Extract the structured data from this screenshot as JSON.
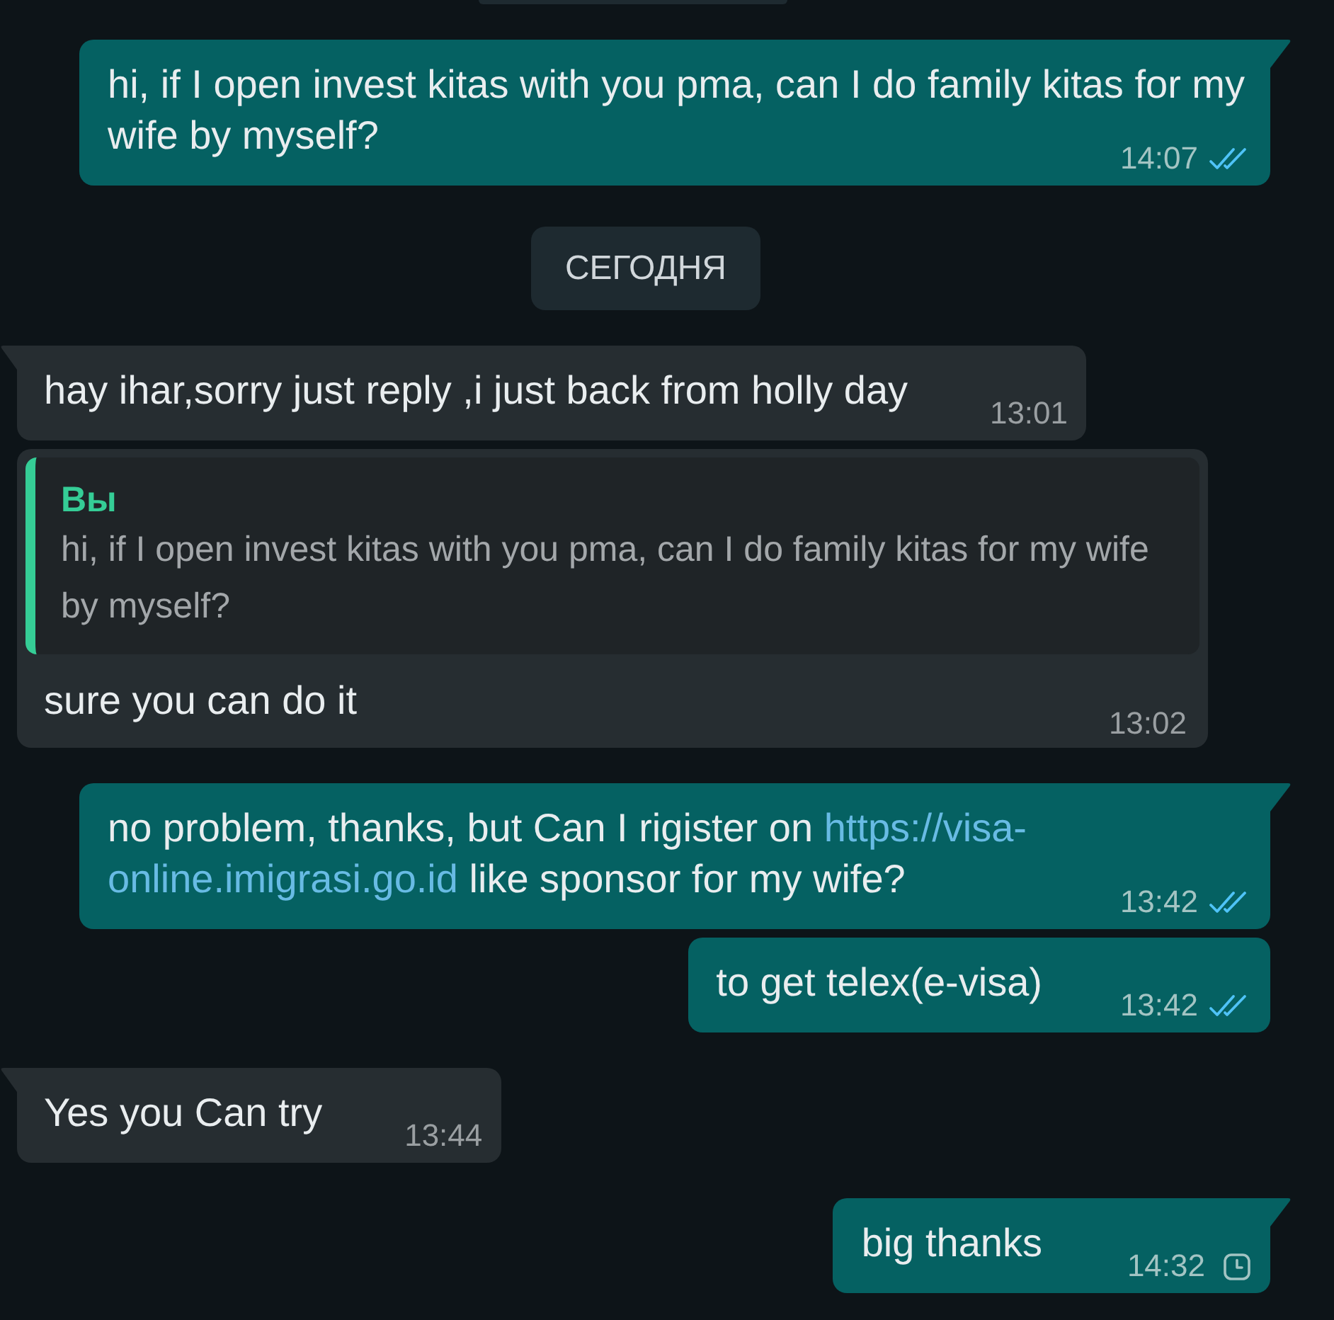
{
  "chat": {
    "messages": [
      {
        "kind": "outgoing",
        "tail": true,
        "text": "hi, if I open invest kitas with you pma, can I do family kitas for my wife by myself?",
        "time": "14:07",
        "pending": false,
        "read": true
      },
      {
        "kind": "date",
        "text": "СЕГОДНЯ"
      },
      {
        "kind": "incoming",
        "tail": true,
        "text": "hay ihar,sorry just reply ,i just back from holly day",
        "time": "13:01"
      },
      {
        "kind": "incoming",
        "tail": false,
        "quote": {
          "author": "Вы",
          "text": "hi, if I open invest kitas with you pma, can I do family kitas for my wife by myself?"
        },
        "text": "sure you can do it",
        "time": "13:02"
      },
      {
        "kind": "outgoing",
        "tail": true,
        "parts": [
          {
            "kind": "text",
            "text": "no problem, thanks, but Can I rigister on "
          },
          {
            "kind": "link",
            "text": "https://visa-"
          },
          {
            "kind": "link",
            "text": "online.imigrasi.go.id"
          },
          {
            "kind": "text",
            "text": " like sponsor for my wife?"
          }
        ],
        "time": "13:42",
        "pending": false,
        "read": true
      },
      {
        "kind": "outgoing",
        "tail": false,
        "text": "to get telex(e-visa)",
        "time": "13:42",
        "pending": false,
        "read": true
      },
      {
        "kind": "incoming",
        "tail": true,
        "text": "Yes you Can try",
        "time": "13:44"
      },
      {
        "kind": "outgoing",
        "tail": true,
        "text": "big thanks",
        "time": "14:32",
        "pending": true
      }
    ]
  }
}
